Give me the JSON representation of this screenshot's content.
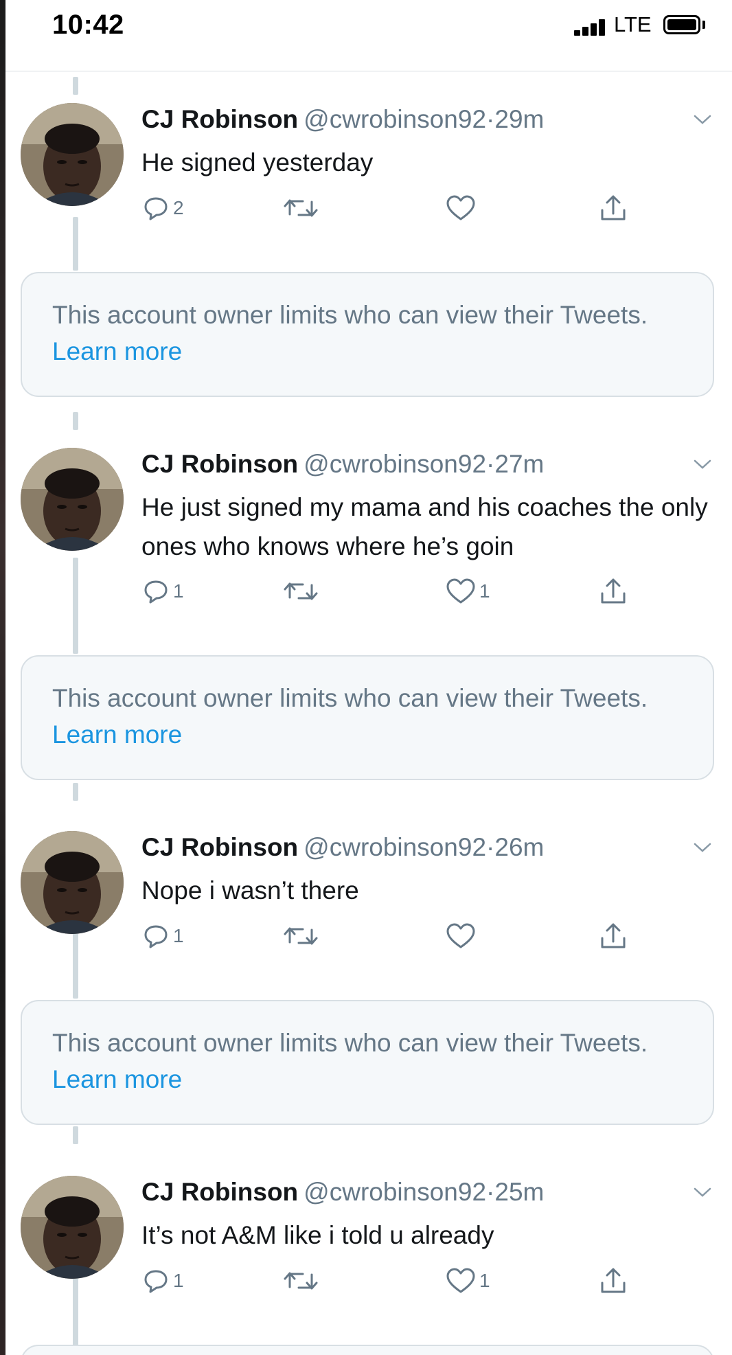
{
  "status_bar": {
    "time": "10:42",
    "carrier": "LTE"
  },
  "colors": {
    "link": "#1b95e0",
    "secondary_text": "#657786",
    "primary_text": "#14171a",
    "limit_box_bg": "#f5f8fa"
  },
  "tweets": [
    {
      "name": "CJ Robinson",
      "handle": "@cwrobinson92",
      "dot": "·",
      "time": "29m",
      "text": "He signed yesterday",
      "reply_count": "2",
      "retweet_count": "",
      "like_count": ""
    },
    {
      "name": "CJ Robinson",
      "handle": "@cwrobinson92",
      "dot": "·",
      "time": "27m",
      "text": "He just signed my mama and his coaches the only ones who knows where he’s goin",
      "reply_count": "1",
      "retweet_count": "",
      "like_count": "1"
    },
    {
      "name": "CJ Robinson",
      "handle": "@cwrobinson92",
      "dot": "·",
      "time": "26m",
      "text": "Nope i wasn’t there",
      "reply_count": "1",
      "retweet_count": "",
      "like_count": ""
    },
    {
      "name": "CJ Robinson",
      "handle": "@cwrobinson92",
      "dot": "·",
      "time": "25m",
      "text": "It’s not A&M like i told u already",
      "reply_count": "1",
      "retweet_count": "",
      "like_count": "1"
    }
  ],
  "limit_notice": {
    "text": "This account owner limits who can view their Tweets.",
    "link": "Learn more"
  },
  "icons": [
    "reply-icon",
    "retweet-icon",
    "like-icon",
    "share-icon",
    "caret-down-icon"
  ]
}
